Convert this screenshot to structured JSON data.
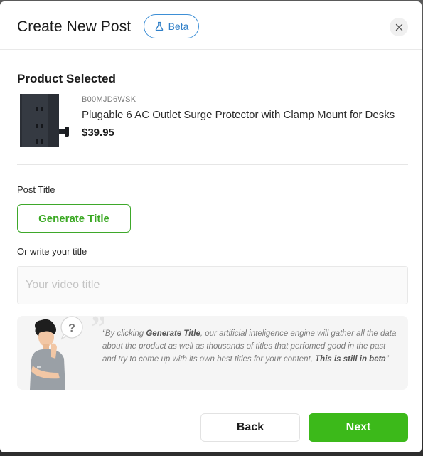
{
  "header": {
    "title": "Create New Post",
    "beta_label": "Beta",
    "beta_icon": "flask-icon",
    "close_icon": "close-icon"
  },
  "product": {
    "section_title": "Product Selected",
    "sku": "B00MJD6WSK",
    "name": "Plugable 6 AC Outlet Surge Protector with Clamp Mount for Desks",
    "price": "$39.95"
  },
  "post_title": {
    "label": "Post Title",
    "generate_button": "Generate Title",
    "alt_label": "Or write your title",
    "input_placeholder": "Your video title",
    "input_value": ""
  },
  "info": {
    "segments": [
      "“By clicking ",
      "Generate Title",
      ", our artificial inteligence engine will gather all the data about the product as well as thousands of titles that perfomed good in the past and try to come up with its own best titles for your content, ",
      "This is still in beta",
      "”"
    ],
    "bubble_glyph": "?"
  },
  "footer": {
    "back_label": "Back",
    "next_label": "Next"
  },
  "colors": {
    "accent_green": "#3cb91a",
    "beta_blue": "#2f7fc8"
  }
}
